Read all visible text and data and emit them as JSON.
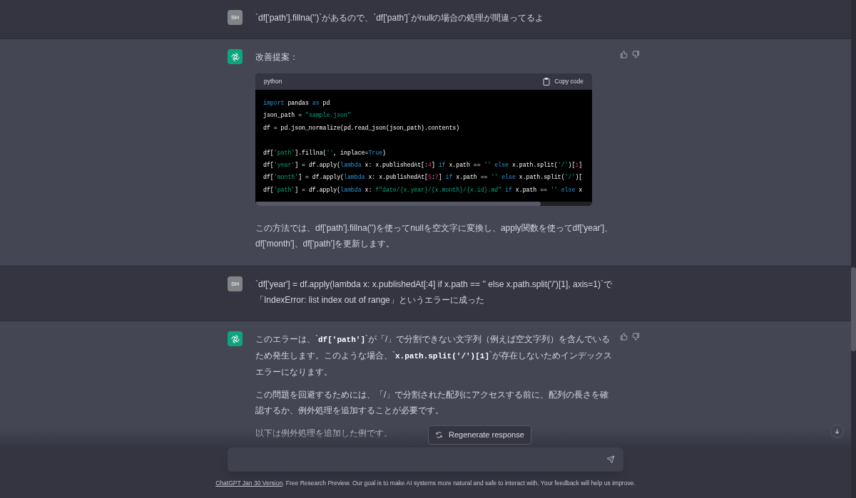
{
  "messages": [
    {
      "kind": "user",
      "avatar": "SH",
      "paragraphs": [
        [
          {
            "kind": "text",
            "text": "`df['path'].fillna('')`があるので、`df['path']`がnullの場合の処理が間違ってるよ"
          }
        ]
      ]
    },
    {
      "kind": "assistant",
      "paragraphs": [
        [
          {
            "kind": "text",
            "text": "改善提案："
          }
        ]
      ],
      "code_block": {
        "language": "python",
        "copy_label": "Copy code",
        "blocks": [
          [
            [
              {
                "kind": "keyword",
                "text": "import"
              },
              {
                "kind": "plain",
                "text": " pandas "
              },
              {
                "kind": "keyword",
                "text": "as"
              },
              {
                "kind": "plain",
                "text": " pd"
              }
            ],
            [
              {
                "kind": "plain",
                "text": "json_path = "
              },
              {
                "kind": "string",
                "text": "\"sample.json\""
              }
            ],
            [
              {
                "kind": "plain",
                "text": "df = pd.json_normalize(pd.read_json(json_path).contents)"
              }
            ]
          ],
          [
            [
              {
                "kind": "plain",
                "text": "df["
              },
              {
                "kind": "string",
                "text": "'path'"
              },
              {
                "kind": "plain",
                "text": "].fillna("
              },
              {
                "kind": "string",
                "text": "''"
              },
              {
                "kind": "plain",
                "text": ", inplace="
              },
              {
                "kind": "keyword",
                "text": "True"
              },
              {
                "kind": "plain",
                "text": ")"
              }
            ],
            [
              {
                "kind": "plain",
                "text": "df["
              },
              {
                "kind": "string",
                "text": "'year'"
              },
              {
                "kind": "plain",
                "text": "] = df.apply("
              },
              {
                "kind": "keyword",
                "text": "lambda"
              },
              {
                "kind": "plain",
                "text": " x: x.publishedAt[:"
              },
              {
                "kind": "number",
                "text": "4"
              },
              {
                "kind": "plain",
                "text": "] "
              },
              {
                "kind": "keyword",
                "text": "if"
              },
              {
                "kind": "plain",
                "text": " x.path == "
              },
              {
                "kind": "string",
                "text": "''"
              },
              {
                "kind": "keyword",
                "text": " else"
              },
              {
                "kind": "plain",
                "text": " x.path.split("
              },
              {
                "kind": "string",
                "text": "'/'"
              },
              {
                "kind": "plain",
                "text": ")["
              },
              {
                "kind": "number",
                "text": "1"
              },
              {
                "kind": "plain",
                "text": "]"
              }
            ],
            [
              {
                "kind": "plain",
                "text": "df["
              },
              {
                "kind": "string",
                "text": "'month'"
              },
              {
                "kind": "plain",
                "text": "] = df.apply("
              },
              {
                "kind": "keyword",
                "text": "lambda"
              },
              {
                "kind": "plain",
                "text": " x: x.publishedAt["
              },
              {
                "kind": "number",
                "text": "5"
              },
              {
                "kind": "plain",
                "text": ":"
              },
              {
                "kind": "number",
                "text": "7"
              },
              {
                "kind": "plain",
                "text": "] "
              },
              {
                "kind": "keyword",
                "text": "if"
              },
              {
                "kind": "plain",
                "text": " x.path == "
              },
              {
                "kind": "string",
                "text": "''"
              },
              {
                "kind": "keyword",
                "text": " else"
              },
              {
                "kind": "plain",
                "text": " x.path.split("
              },
              {
                "kind": "string",
                "text": "'/'"
              },
              {
                "kind": "plain",
                "text": ")["
              }
            ],
            [
              {
                "kind": "plain",
                "text": "df["
              },
              {
                "kind": "string",
                "text": "'path'"
              },
              {
                "kind": "plain",
                "text": "] = df.apply("
              },
              {
                "kind": "keyword",
                "text": "lambda"
              },
              {
                "kind": "plain",
                "text": " x: "
              },
              {
                "kind": "string",
                "text": "f\"date/{x.year}/{x.month}/{x.id}.md\""
              },
              {
                "kind": "keyword",
                "text": " if"
              },
              {
                "kind": "plain",
                "text": " x.path == "
              },
              {
                "kind": "string",
                "text": "''"
              },
              {
                "kind": "keyword",
                "text": " else"
              },
              {
                "kind": "plain",
                "text": " x"
              }
            ]
          ]
        ]
      },
      "after": [
        [
          {
            "kind": "text",
            "text": "この方法では、df['path'].fillna('')を使ってnullを空文字に変換し、apply関数を使ってdf['year']、df['month']、df['path']を更新します。"
          }
        ]
      ]
    },
    {
      "kind": "user",
      "avatar": "SH",
      "paragraphs": [
        [
          {
            "kind": "text",
            "text": "`df['year'] = df.apply(lambda x: x.publishedAt[:4] if x.path == '' else x.path.split('/')[1], axis=1)`で「IndexError: list index out of range」というエラーに成った"
          }
        ]
      ]
    },
    {
      "kind": "assistant",
      "paragraphs": [
        [
          {
            "kind": "text",
            "text": "このエラーは、`"
          },
          {
            "kind": "code",
            "text": "df['path']"
          },
          {
            "kind": "text",
            "text": "`が「/」で分割できない文字列（例えば空文字列）を含んでいるため発生します。このような場合、`"
          },
          {
            "kind": "code",
            "text": "x.path.split('/')[1]"
          },
          {
            "kind": "text",
            "text": "`が存在しないためインデックスエラーになります。"
          }
        ],
        [
          {
            "kind": "text",
            "text": "この問題を回避するためには、「/」で分割された配列にアクセスする前に、配列の長さを確認するか、例外処理を追加することが必要です。"
          }
        ],
        [
          {
            "kind": "text",
            "text": "以下は例外処理を追加した例です。"
          }
        ]
      ]
    }
  ],
  "regenerate_button": "Regenerate response",
  "footer": {
    "link": "ChatGPT Jan 30 Version",
    "text": ". Free Research Preview. Our goal is to make AI systems more natural and safe to interact with. Your feedback will help us improve."
  }
}
